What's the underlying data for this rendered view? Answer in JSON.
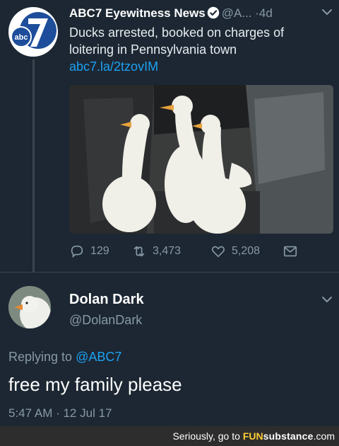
{
  "tweet": {
    "author_name": "ABC7 Eyewitness News",
    "handle": "@A...",
    "separator": "·",
    "time": "4d",
    "text": "Ducks arrested, booked on charges of loitering in Pennsylvania town",
    "link": "abc7.la/2tzovIM",
    "avatar_logo_text": "abc",
    "avatar_logo_number": "7",
    "icons": [
      "verified-badge-icon",
      "chevron-down-icon",
      "reply-icon",
      "retweet-icon",
      "like-icon",
      "message-icon"
    ],
    "actions": {
      "replies": "129",
      "retweets": "3,473",
      "likes": "5,208"
    }
  },
  "reply": {
    "author_name": "Dolan Dark",
    "handle": "@DolanDark",
    "replying_prefix": "Replying to",
    "replying_to": "@ABC7",
    "text": "free my family please",
    "timestamp": "5:47 AM · 12 Jul 17"
  },
  "watermark": {
    "prefix": "Seriously, go to ",
    "brand_fun": "FUN",
    "brand_rest": "substance",
    "suffix": ".com"
  },
  "colors": {
    "background": "#1c2733",
    "link": "#1da1f2",
    "muted": "#8899a6"
  }
}
